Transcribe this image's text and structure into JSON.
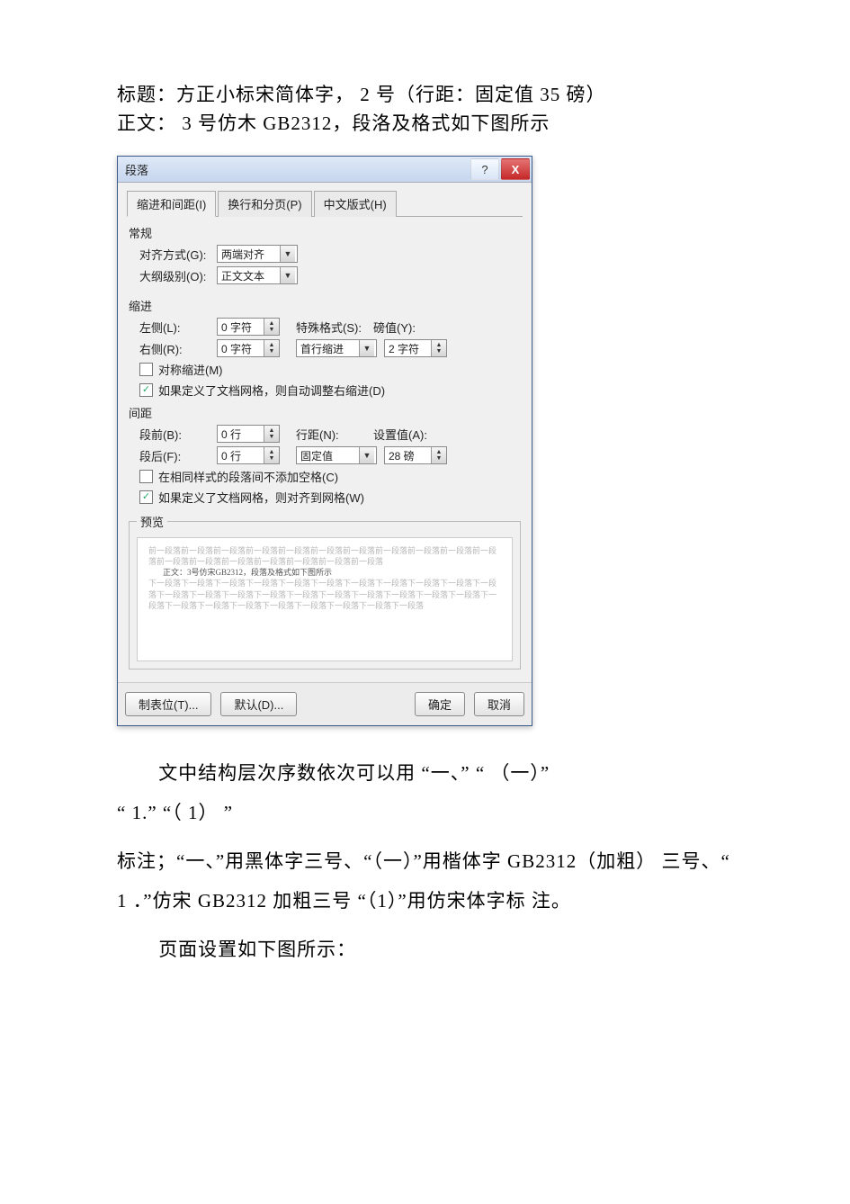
{
  "intro": {
    "line1": "标题：方正小标宋简体字，   2 号（行距：固定值  35  磅）",
    "line2": "正文：  3 号仿木 GB2312，段洛及格式如下图所示"
  },
  "dialog": {
    "title": "段落",
    "help_icon": "?",
    "close_icon": "X",
    "tabs": {
      "t1": "缩进和间距(I)",
      "t2": "换行和分页(P)",
      "t3": "中文版式(H)"
    },
    "general": {
      "heading": "常规",
      "align_label": "对齐方式(G):",
      "align_value": "两端对齐",
      "outline_label": "大纲级别(O):",
      "outline_value": "正文文本"
    },
    "indent": {
      "heading": "缩进",
      "left_label": "左侧(L):",
      "left_value": "0 字符",
      "right_label": "右侧(R):",
      "right_value": "0 字符",
      "special_label": "特殊格式(S):",
      "special_value": "首行缩进",
      "by_label": "磅值(Y):",
      "by_value": "2 字符",
      "mirror_cb": "对称缩进(M)",
      "grid_cb": "如果定义了文档网格，则自动调整右缩进(D)"
    },
    "spacing": {
      "heading": "间距",
      "before_label": "段前(B):",
      "before_value": "0 行",
      "after_label": "段后(F):",
      "after_value": "0 行",
      "line_label": "行距(N):",
      "line_value": "固定值",
      "at_label": "设置值(A):",
      "at_value": "28 磅",
      "nospace_cb": "在相同样式的段落间不添加空格(C)",
      "snap_cb": "如果定义了文档网格，则对齐到网格(W)"
    },
    "preview": {
      "legend": "预览",
      "gray1": "前一段落前一段落前一段落前一段落前一段落前一段落前一段落前一段落前一段落前一段落前一段落前一段落前一段落前一段落前一段落前一段落前一段落前一段落",
      "dark": "正文：3号仿宋GB2312，段落及格式如下图所示",
      "gray2": "下一段落下一段落下一段落下一段落下一段落下一段落下一段落下一段落下一段落下一段落下一段落下一段落下一段落下一段落下一段落下一段落下一段落下一段落下一段落下一段落下一段落下一段落下一段落下一段落下一段落下一段落下一段落下一段落下一段落下一段落"
    },
    "buttons": {
      "tabs_btn": "制表位(T)...",
      "default_btn": "默认(D)...",
      "ok": "确定",
      "cancel": "取消"
    }
  },
  "body": {
    "p1a": "文中结构层次序数依次可以用     “一、”   “ （一）”",
    "p1b": "“ 1.”  “（ 1） ”",
    "p2": "标注；“一、”用黑体字三号、“（一）”用楷体字 GB2312（加粗） 三号、“ 1 ．”仿宋 GB2312 加粗三号  “（1）”用仿宋体字标 注。",
    "p3": "页面设置如下图所示："
  }
}
